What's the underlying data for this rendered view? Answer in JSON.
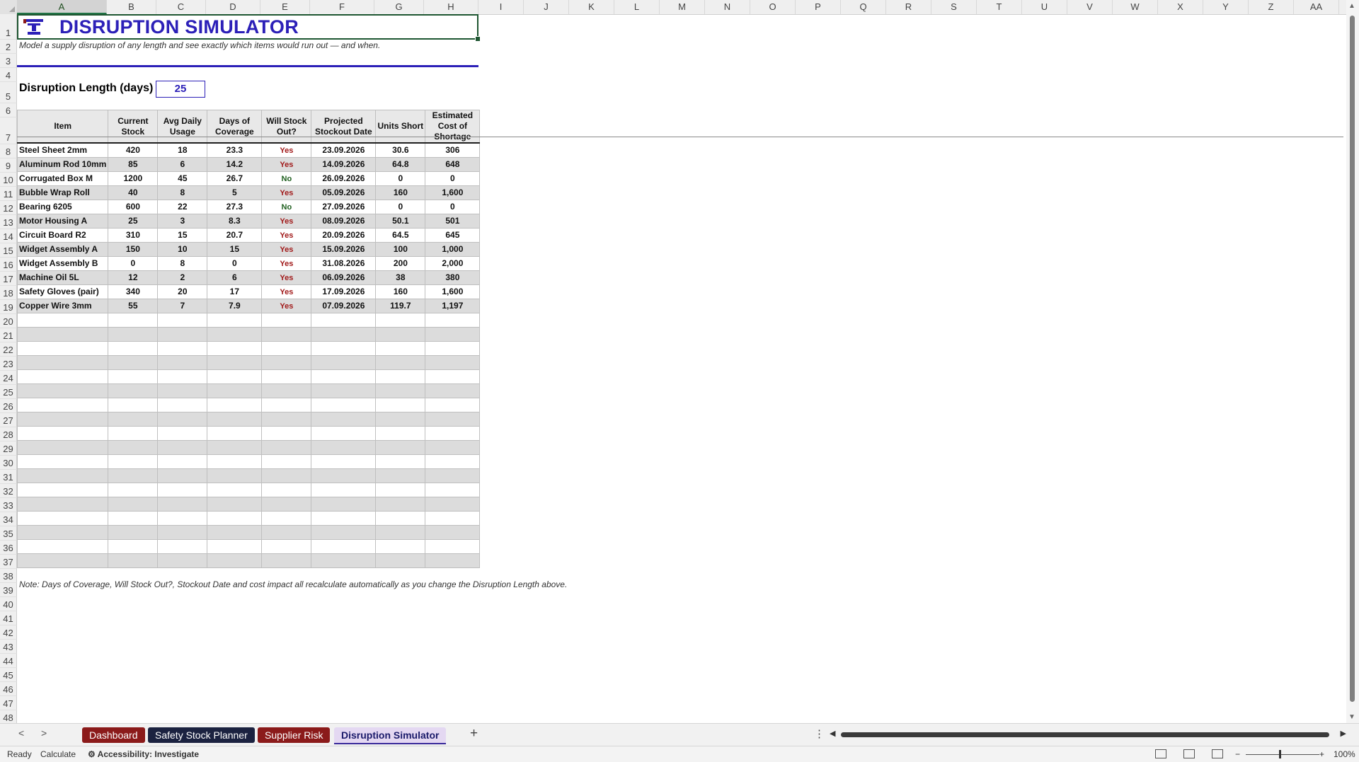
{
  "sheet": {
    "columns": [
      "A",
      "B",
      "C",
      "D",
      "E",
      "F",
      "G",
      "H",
      "I",
      "J",
      "K",
      "L",
      "M",
      "N",
      "O",
      "P",
      "Q",
      "R",
      "S",
      "T",
      "U",
      "V",
      "W",
      "X",
      "Y",
      "Z",
      "AA"
    ],
    "row_count": 48,
    "title": "DISRUPTION SIMULATOR",
    "subtitle": "Model a supply disruption of any length and see exactly which items would run out — and when.",
    "disruption_label": "Disruption Length (days)",
    "disruption_value": "25",
    "headers": [
      "Item",
      "Current Stock",
      "Avg Daily Usage",
      "Days of Coverage",
      "Will Stock Out?",
      "Projected Stockout Date",
      "Units Short",
      "Estimated Cost of Shortage"
    ],
    "rows": [
      [
        "Steel Sheet 2mm",
        "420",
        "18",
        "23.3",
        "Yes",
        "23.09.2026",
        "30.6",
        "306"
      ],
      [
        "Aluminum Rod 10mm",
        "85",
        "6",
        "14.2",
        "Yes",
        "14.09.2026",
        "64.8",
        "648"
      ],
      [
        "Corrugated Box M",
        "1200",
        "45",
        "26.7",
        "No",
        "26.09.2026",
        "0",
        "0"
      ],
      [
        "Bubble Wrap Roll",
        "40",
        "8",
        "5",
        "Yes",
        "05.09.2026",
        "160",
        "1,600"
      ],
      [
        "Bearing 6205",
        "600",
        "22",
        "27.3",
        "No",
        "27.09.2026",
        "0",
        "0"
      ],
      [
        "Motor Housing A",
        "25",
        "3",
        "8.3",
        "Yes",
        "08.09.2026",
        "50.1",
        "501"
      ],
      [
        "Circuit Board R2",
        "310",
        "15",
        "20.7",
        "Yes",
        "20.09.2026",
        "64.5",
        "645"
      ],
      [
        "Widget Assembly A",
        "150",
        "10",
        "15",
        "Yes",
        "15.09.2026",
        "100",
        "1,000"
      ],
      [
        "Widget Assembly B",
        "0",
        "8",
        "0",
        "Yes",
        "31.08.2026",
        "200",
        "2,000"
      ],
      [
        "Machine Oil 5L",
        "12",
        "2",
        "6",
        "Yes",
        "06.09.2026",
        "38",
        "380"
      ],
      [
        "Safety Gloves (pair)",
        "340",
        "20",
        "17",
        "Yes",
        "17.09.2026",
        "160",
        "1,600"
      ],
      [
        "Copper Wire 3mm",
        "55",
        "7",
        "7.9",
        "Yes",
        "07.09.2026",
        "119.7",
        "1,197"
      ]
    ],
    "empty_rows": 18,
    "note": "Note: Days of Coverage, Will Stock Out?, Stockout Date and cost impact all recalculate automatically as you change the Disruption Length above."
  },
  "tabs": [
    {
      "label": "Dashboard",
      "color": "#8b1a1a",
      "active": false
    },
    {
      "label": "Safety Stock Planner",
      "color": "#1b2240",
      "active": false
    },
    {
      "label": "Supplier Risk",
      "color": "#8b1a1a",
      "active": false
    },
    {
      "label": "Disruption Simulator",
      "color": "#e4d8f2",
      "active": true
    }
  ],
  "status": {
    "ready": "Ready",
    "calculate": "Calculate",
    "accessibility": "Accessibility: Investigate",
    "zoom": "100%"
  },
  "colors": {
    "title": "#2c20b8",
    "yes": "#a11a1a",
    "no": "#1f5f1f"
  }
}
